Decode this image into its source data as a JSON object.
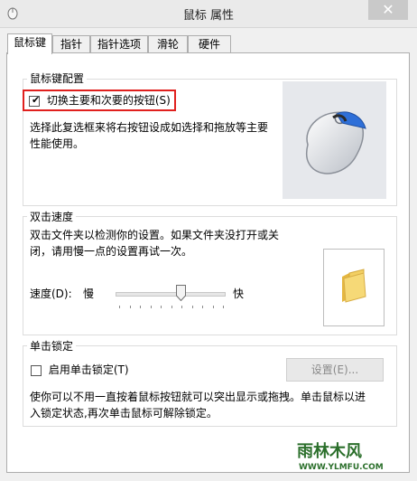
{
  "window": {
    "title": "鼠标 属性",
    "close": "✕"
  },
  "tabs": [
    {
      "label": "鼠标键",
      "active": true
    },
    {
      "label": "指针"
    },
    {
      "label": "指针选项"
    },
    {
      "label": "滑轮"
    },
    {
      "label": "硬件"
    }
  ],
  "button_config": {
    "title": "鼠标键配置",
    "checkbox_label": "切换主要和次要的按钮(S)",
    "checked": true,
    "description_line1": "选择此复选框来将右按钮设成如选择和拖放等主要",
    "description_line2": "性能使用。"
  },
  "double_click": {
    "title": "双击速度",
    "description_line1": "双击文件夹以检测你的设置。如果文件夹没打开或关",
    "description_line2": "闭，请用慢一点的设置再试一次。",
    "speed_label": "速度(D):",
    "slow": "慢",
    "fast": "快",
    "speed_fraction": 0.6
  },
  "click_lock": {
    "title": "单击锁定",
    "checkbox_label": "启用单击锁定(T)",
    "checked": false,
    "settings_button": "设置(E)...",
    "description_line1": "使你可以不用一直按着鼠标按钮就可以突出显示或拖拽。单击鼠标以进",
    "description_line2": "入锁定状态,再次单击鼠标可解除锁定。"
  },
  "watermark": {
    "brand": "雨林木风",
    "url": "WWW.YLMFU.COM"
  },
  "colors": {
    "highlight": "#e0201e",
    "mouse_accent": "#2e6fd8",
    "folder": "#f2cf63"
  }
}
